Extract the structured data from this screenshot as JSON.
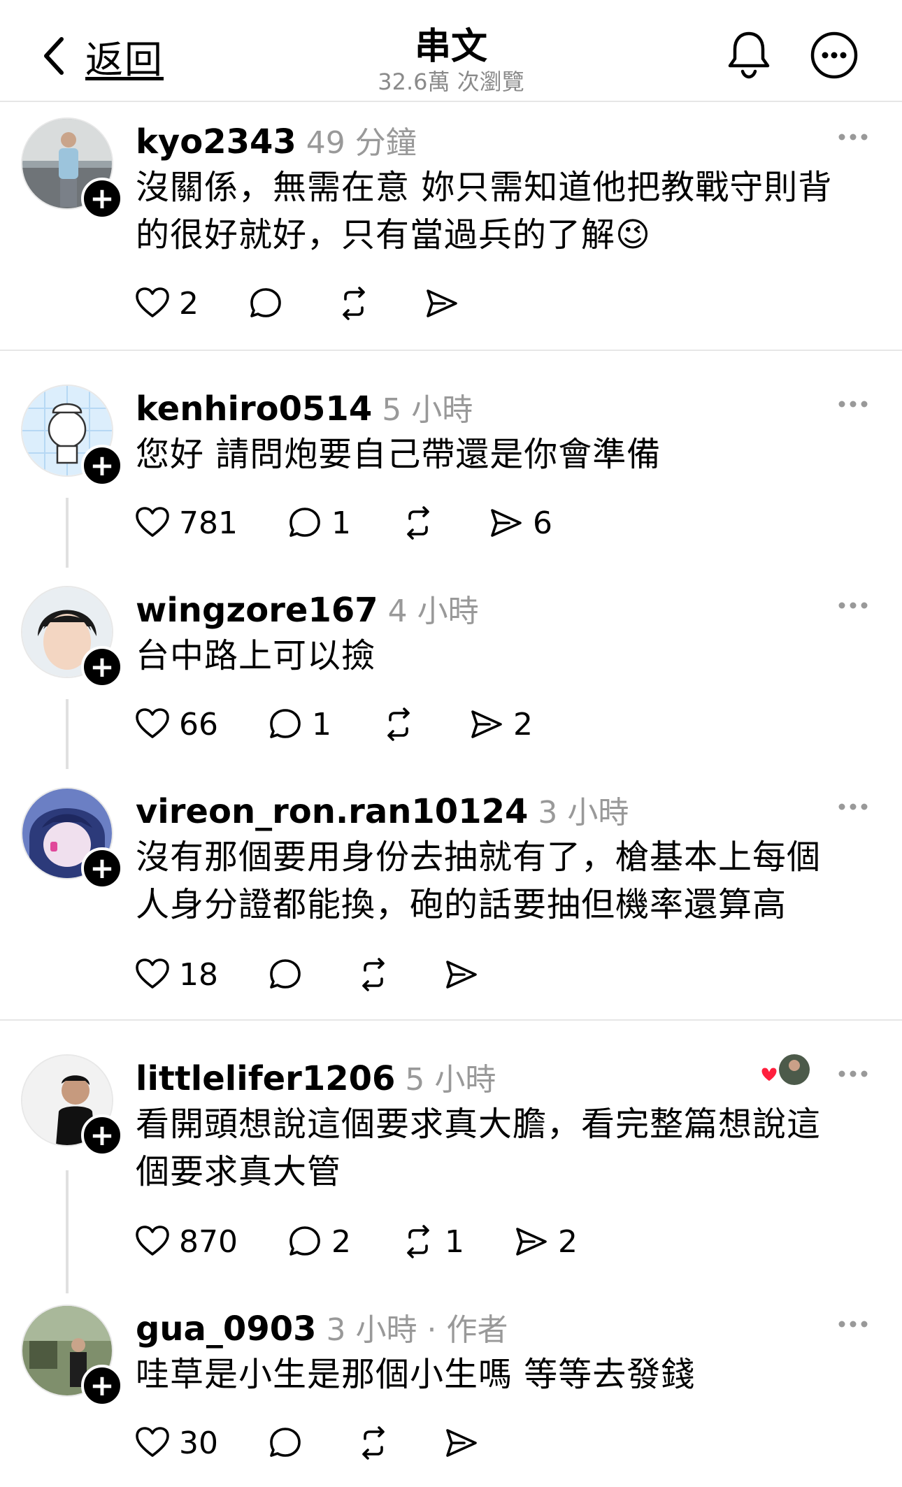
{
  "header": {
    "back_label": "返回",
    "title": "串文",
    "views": "32.6萬 次瀏覽"
  },
  "posts": [
    {
      "username": "kyo2343",
      "time": "49 分鐘",
      "text_lines": [
        "沒關係，無需在意 妳只需知道他把教戰守則背",
        "的很好就好，只有當過兵的了解😉"
      ],
      "likes": "2",
      "replies": "",
      "reposts": "",
      "shares": ""
    },
    {
      "username": "kenhiro0514",
      "time": "5 小時",
      "text_lines": [
        "您好 請問炮要自己帶還是你會準備"
      ],
      "likes": "781",
      "replies": "1",
      "reposts": "",
      "shares": "6"
    },
    {
      "username": "wingzore167",
      "time": "4 小時",
      "text_lines": [
        "台中路上可以撿"
      ],
      "likes": "66",
      "replies": "1",
      "reposts": "",
      "shares": "2"
    },
    {
      "username": "vireon_ron.ran10124",
      "time": "3 小時",
      "text_lines": [
        "沒有那個要用身份去抽就有了，槍基本上每個",
        "人身分證都能換，砲的話要抽但機率還算高"
      ],
      "likes": "18",
      "replies": "",
      "reposts": "",
      "shares": ""
    },
    {
      "username": "littlelifer1206",
      "time": "5 小時",
      "text_lines": [
        "看開頭想說這個要求真大膽，看完整篇想說這",
        "個要求真大管"
      ],
      "likes": "870",
      "replies": "2",
      "reposts": "1",
      "shares": "2"
    },
    {
      "username": "gua_0903",
      "time": "3 小時 · 作者",
      "text_lines": [
        "哇草是小生是那個小生嗎 等等去發錢"
      ],
      "likes": "30",
      "replies": "",
      "reposts": "",
      "shares": ""
    }
  ],
  "icons": {
    "back": "chevron-left-icon",
    "bell": "bell-icon",
    "more": "more-circle-icon",
    "like": "heart-icon",
    "reply": "comment-icon",
    "repost": "repost-icon",
    "share": "send-icon",
    "follow": "plus-icon",
    "liked_by_author": "heart-badge-icon"
  },
  "colors": {
    "accent": "#000000",
    "secondary_text": "#999999",
    "liked_heart": "#ff1f3d"
  }
}
